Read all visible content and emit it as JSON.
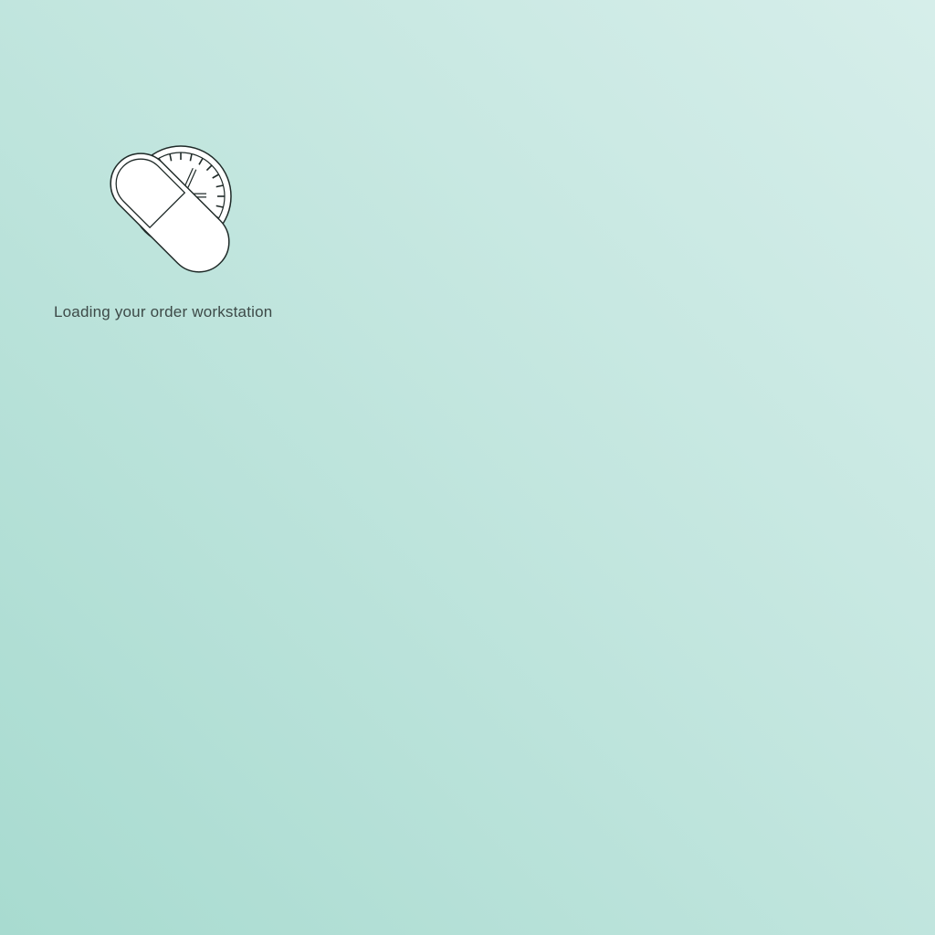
{
  "splash": {
    "logo_icon": "pill-clock-icon",
    "loading_text": "Loading your order workstation"
  },
  "colors": {
    "background_start": "#d6eeea",
    "background_end": "#a8dbd0",
    "text": "#3d4a48",
    "logo_fill": "#ffffff",
    "logo_stroke": "#1f2a28"
  }
}
